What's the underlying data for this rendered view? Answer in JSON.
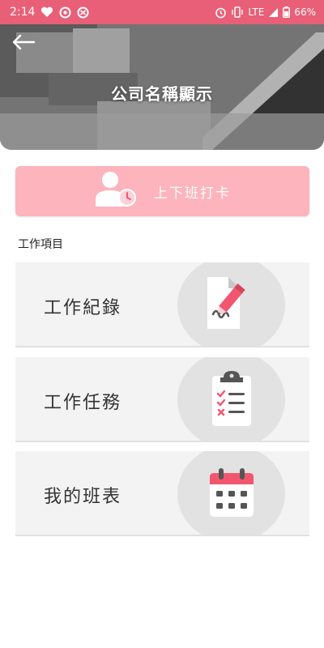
{
  "status_bar": {
    "time": "2:14",
    "network": "LTE",
    "battery": "66%"
  },
  "header": {
    "company_name": "公司名稱顯示"
  },
  "clock_button": {
    "label": "上下班打卡"
  },
  "section_title": "工作項目",
  "cards": [
    {
      "label": "工作紀錄",
      "icon": "document-sign-icon"
    },
    {
      "label": "工作任務",
      "icon": "clipboard-checklist-icon"
    },
    {
      "label": "我的班表",
      "icon": "calendar-icon"
    }
  ],
  "colors": {
    "status_bar": "#e95f77",
    "accent_pink": "#f2566f",
    "clock_button_bg": "#fdb4bd",
    "card_bg": "#f3f3f3",
    "icon_gray": "#555555"
  }
}
